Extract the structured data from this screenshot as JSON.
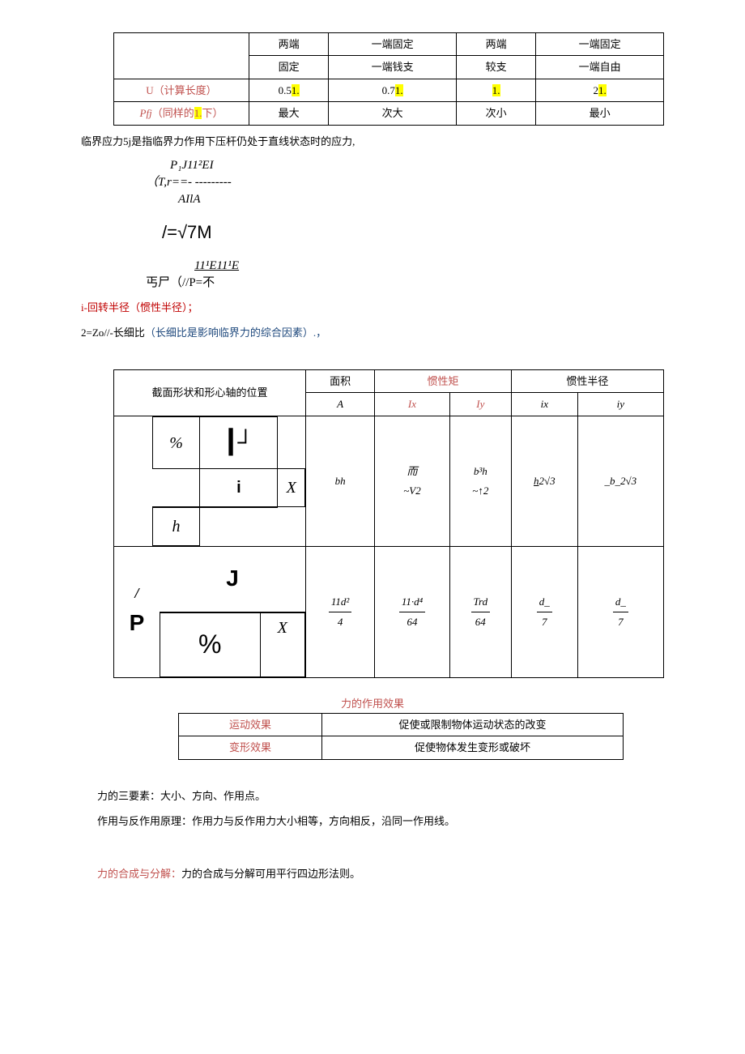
{
  "table1": {
    "headers": [
      "",
      "两端",
      "一端固定",
      "两端",
      "一端固定"
    ],
    "subheaders": [
      "",
      "固定",
      "一端钱支",
      "较支",
      "一端自由"
    ],
    "row1_label": "U（计算长度）",
    "row1": [
      "0.5",
      "0.7",
      "",
      "2"
    ],
    "row1_hl": [
      "1.",
      "1.",
      "1.",
      "1."
    ],
    "row2_label_pre": "Pfj",
    "row2_label": "（同样的",
    "row2_label_hl": "1.",
    "row2_label_post": "下）",
    "row2": [
      "最大",
      "次大",
      "次小",
      "最小"
    ]
  },
  "text1": "临界应力5j是指临界力作用下压杆仍处于直线状态时的应力,",
  "formula1_line1": "P₁J11²EI",
  "formula1_line2": "（T,r==- ---------",
  "formula1_line3": "AIlA",
  "formula2": "/=√7M",
  "formula3_line1": "11¹E11¹E",
  "formula3_line2": "丐尸（//P=不",
  "text2": "i-回转半径（惯性半径）；",
  "text3_pre": "2=Zo//-长细比",
  "text3_blue": "（长细比是影响临界力的综合因素）.，",
  "table2": {
    "h1": "截面形状和形心轴的位置",
    "h2": "面积",
    "h3": "惯性矩",
    "h4": "惯性半径",
    "sub_a": "A",
    "sub_ix_cap": "Ix",
    "sub_iy_cap": "Iy",
    "sub_ix": "ix",
    "sub_iy": "iy",
    "diag1_arrow": "┃┘",
    "diag1_pct": "%",
    "diag1_i": "i",
    "diag1_x": "X",
    "diag1_h": "h",
    "r1_a": "bh",
    "r1_ix_top": "而",
    "r1_ix_bot": "~V2",
    "r1_iy_top": "b³h",
    "r1_iy_bot": "~↑2",
    "r1_ixr_u": "h",
    "r1_ixr": "2√3",
    "r1_iyr_u": "_b_",
    "r1_iyr": "2√3",
    "diag2_J": "J",
    "diag2_slash": "/",
    "diag2_P": "P",
    "diag2_pct": "%",
    "diag2_x": "X",
    "r2_a_num": "11d²",
    "r2_a_den": "4",
    "r2_ix_num": "11·d⁴",
    "r2_ix_den": "64",
    "r2_iy_num": "Trd",
    "r2_iy_den": "64",
    "r2_ixr_num": "d_",
    "r2_ixr_den": "7",
    "r2_iyr_num": "d_",
    "r2_iyr_den": "7"
  },
  "section_title": "力的作用效果",
  "table3": {
    "r1_l": "运动效果",
    "r1_r": "促使或限制物体运动状态的改变",
    "r2_l": "变形效果",
    "r2_r": "促使物体发生变形或破坏"
  },
  "para1": "力的三要素：大小、方向、作用点。",
  "para2": "作用与反作用原理：作用力与反作用力大小相等，方向相反，沿同一作用线。",
  "para3_orange": "力的合成与分解：",
  "para3_rest": "力的合成与分解可用平行四边形法则。"
}
